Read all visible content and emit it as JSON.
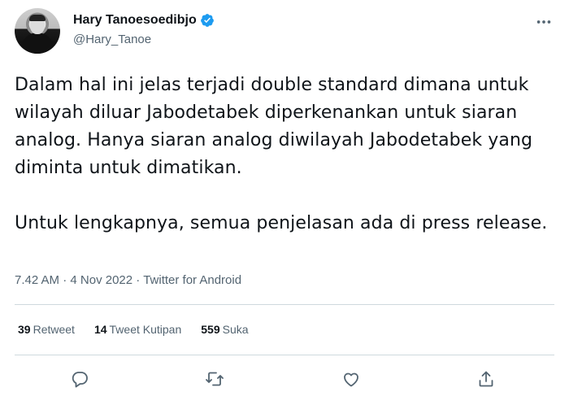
{
  "user": {
    "display_name": "Hary Tanoesoedibjo",
    "handle": "@Hary_Tanoe",
    "verified_icon": "verified-badge-icon",
    "brand_color": "#1d9bf0"
  },
  "tweet": {
    "paragraphs": [
      "Dalam hal ini jelas terjadi double standard dimana untuk wilayah diluar Jabodetabek diperkenankan untuk siaran analog. Hanya siaran analog diwilayah Jabodetabek yang diminta untuk dimatikan.",
      "Untuk lengkapnya, semua penjelasan ada di press release."
    ],
    "time": "7.42 AM",
    "date": "4 Nov 2022",
    "source": "Twitter for Android",
    "separator": " · "
  },
  "stats": {
    "retweets_count": "39",
    "retweets_label": "Retweet",
    "quotes_count": "14",
    "quotes_label": "Tweet Kutipan",
    "likes_count": "559",
    "likes_label": "Suka"
  },
  "actions": {
    "reply_icon": "reply-icon",
    "retweet_icon": "retweet-icon",
    "like_icon": "like-icon",
    "share_icon": "share-icon"
  }
}
